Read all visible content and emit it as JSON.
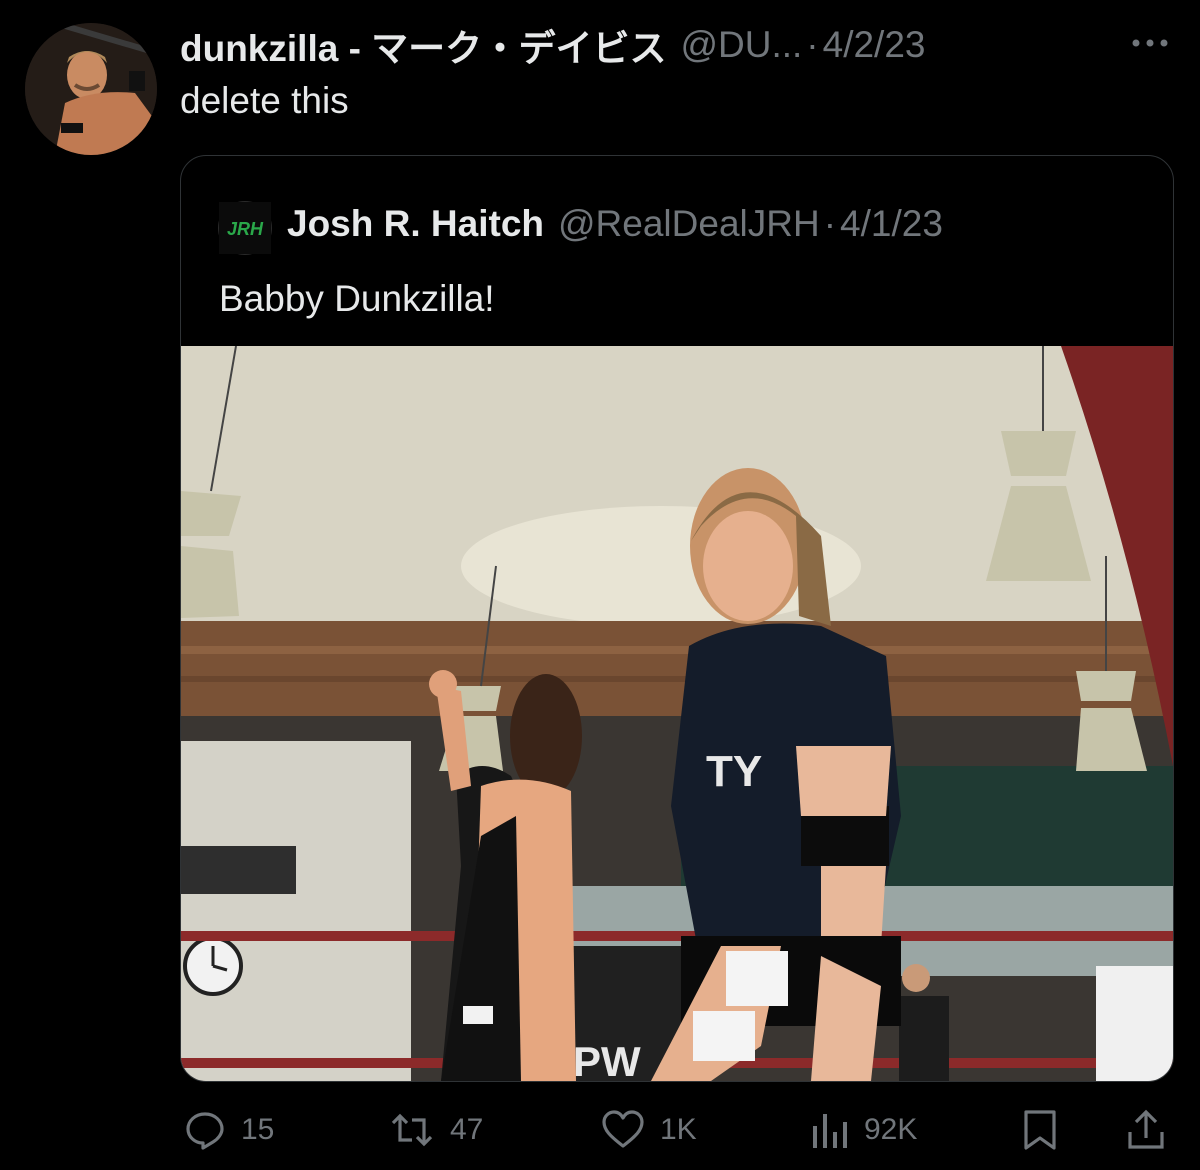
{
  "tweet": {
    "author_name": "dunkzilla - マーク・デイビス",
    "handle": "@DU...",
    "separator": "·",
    "date": "4/2/23",
    "text": "delete this"
  },
  "quoted": {
    "avatar_logo_text": "JRH",
    "author_name": "Josh R. Haitch",
    "handle": "@RealDealJRH",
    "separator": "·",
    "date": "4/1/23",
    "text": "Babby Dunkzilla!",
    "media_text": "PW"
  },
  "actions": {
    "replies": "15",
    "reposts": "47",
    "likes": "1K",
    "views": "92K"
  },
  "icons": [
    "more-icon",
    "reply-icon",
    "repost-icon",
    "like-icon",
    "views-icon",
    "bookmark-icon",
    "share-icon"
  ],
  "colors": {
    "background": "#000000",
    "text": "#e7e9ea",
    "muted": "#71767b",
    "border": "#2f3336",
    "logo_green": "#2aa84a"
  }
}
